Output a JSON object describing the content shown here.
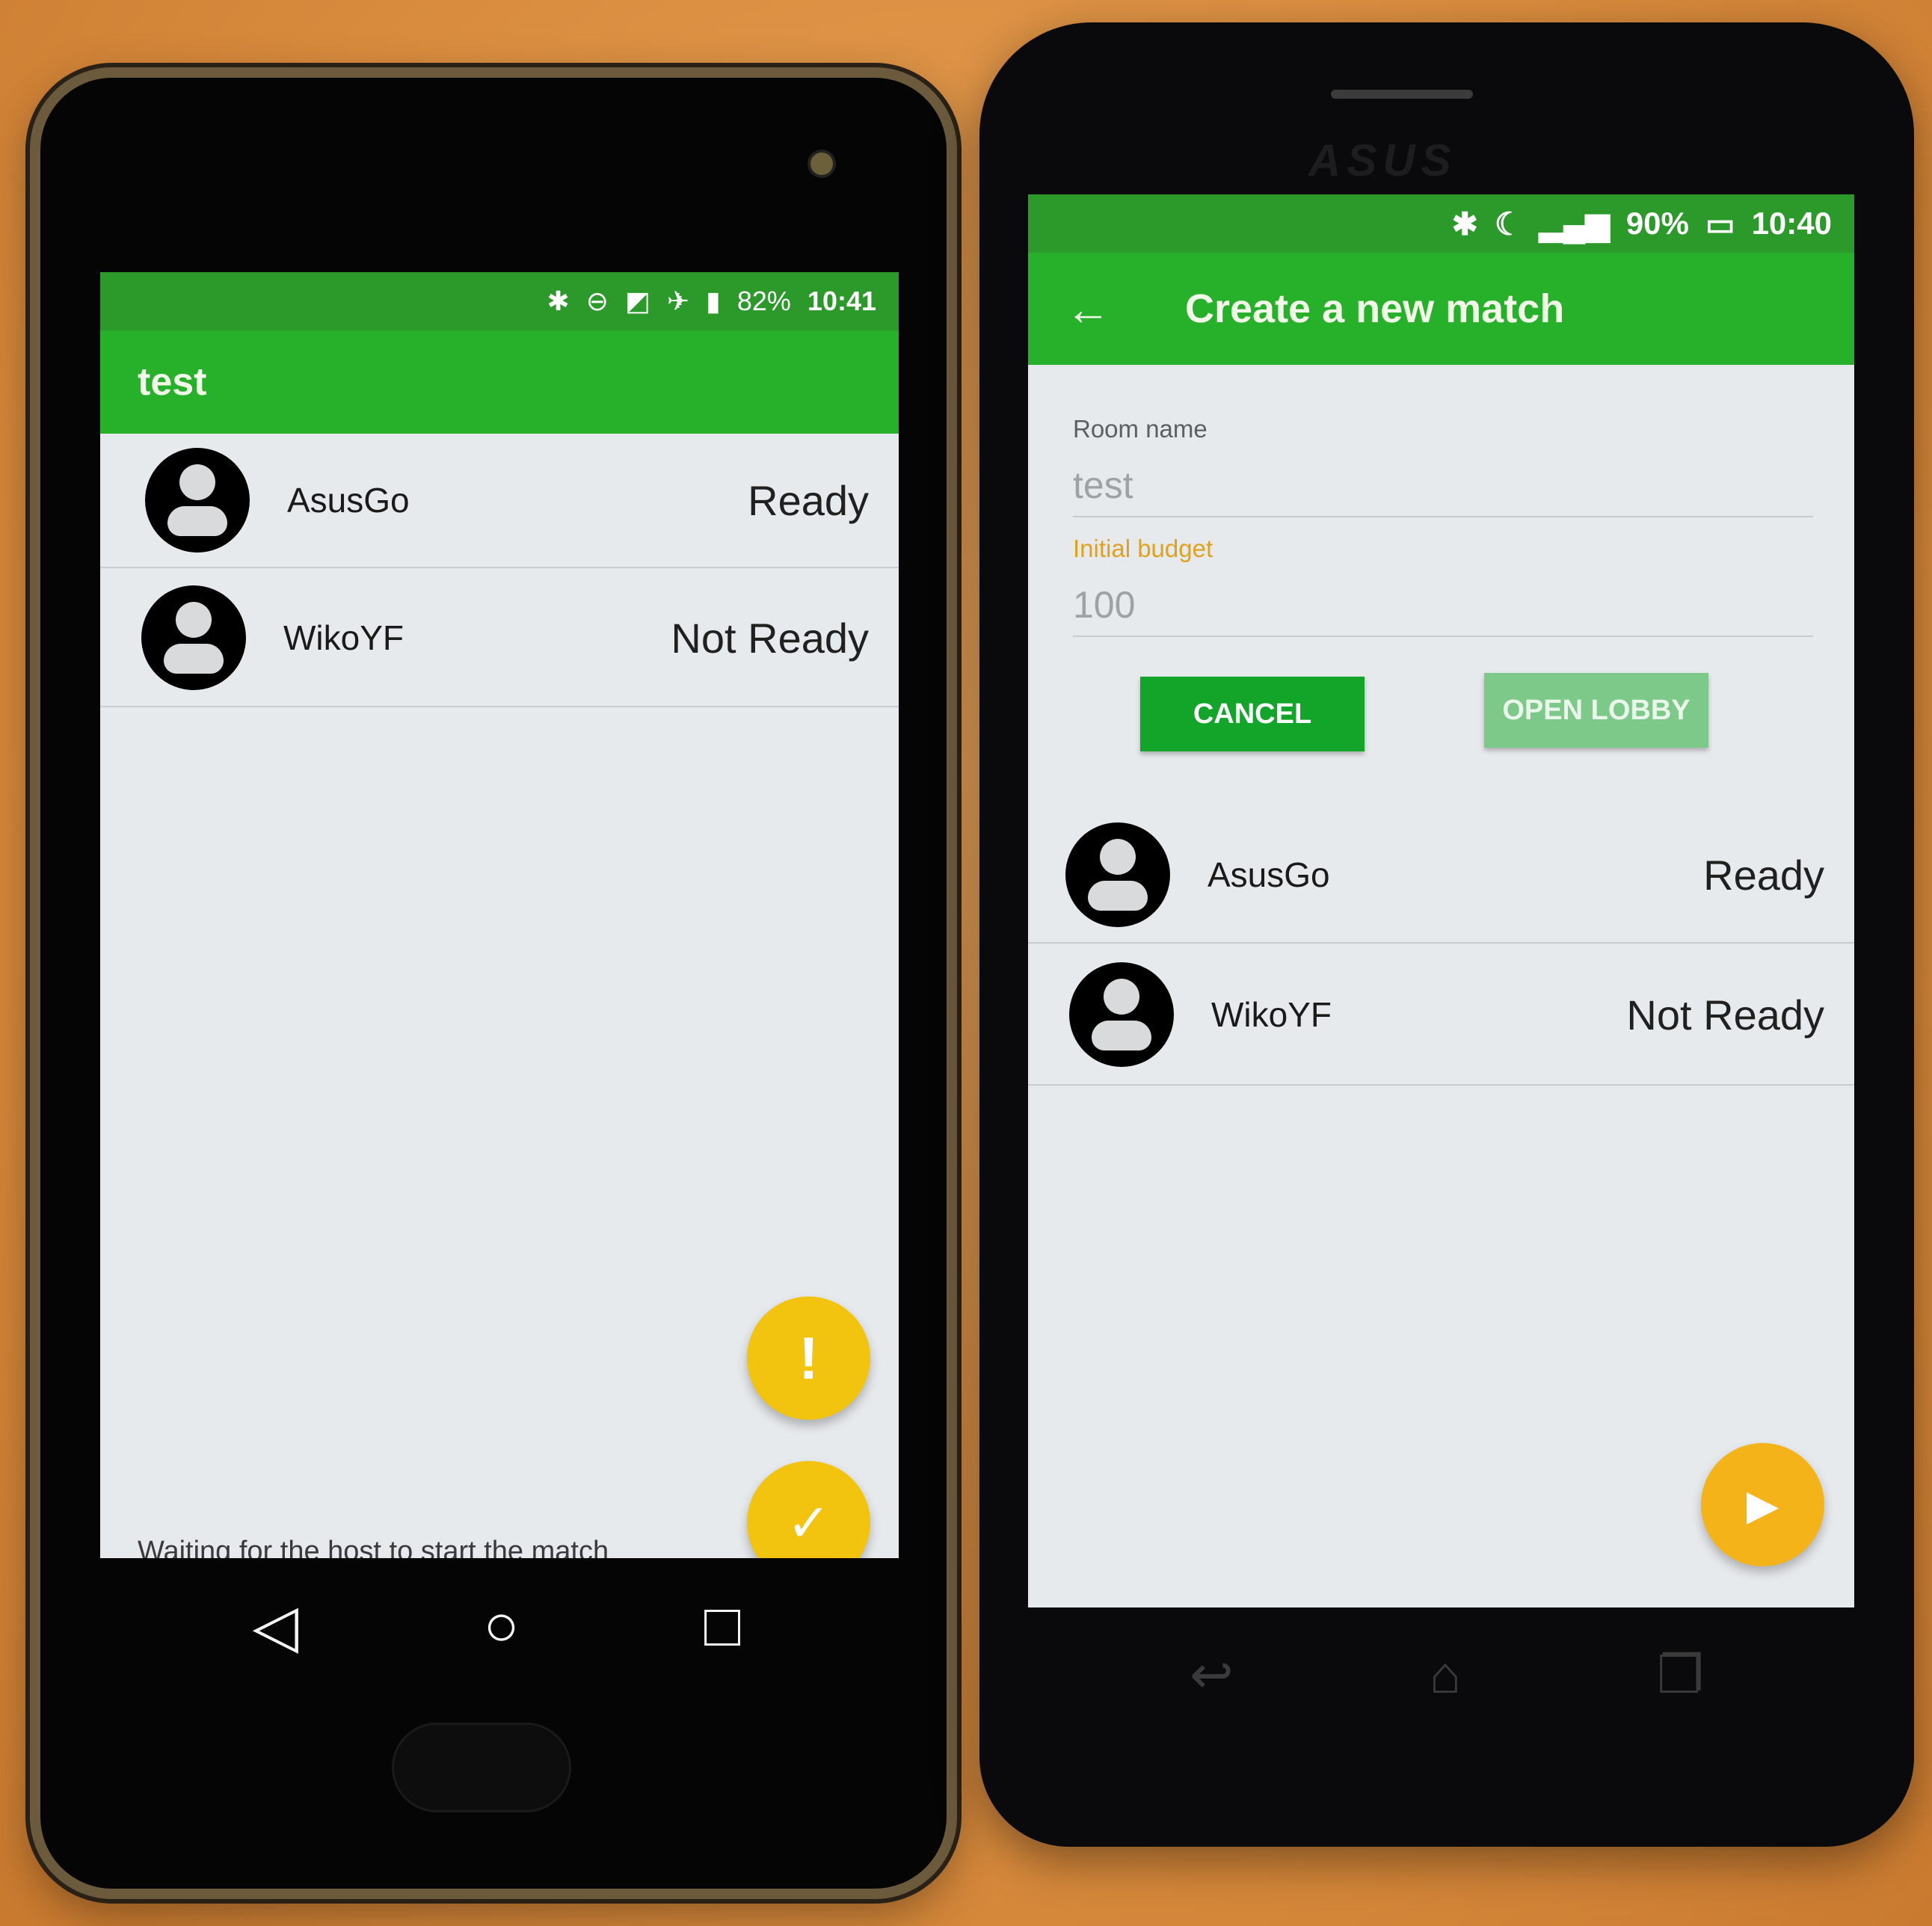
{
  "left_phone": {
    "status_bar": {
      "battery": "82%",
      "time": "10:41"
    },
    "app_bar": {
      "title": "test"
    },
    "players": [
      {
        "name": "AsusGo",
        "status": "Ready"
      },
      {
        "name": "WikoYF",
        "status": "Not Ready"
      }
    ],
    "waiting_text": "Waiting for the host to start the match",
    "fab_alert_icon": "!",
    "fab_ready_icon": "✓",
    "nav": {
      "back": "◁",
      "home": "○",
      "recents": "□"
    }
  },
  "right_phone": {
    "brand": "ASUS",
    "status_bar": {
      "battery": "90%",
      "time": "10:40"
    },
    "app_bar": {
      "back_icon": "←",
      "title": "Create a new match"
    },
    "form": {
      "room_label": "Room name",
      "room_value": "test",
      "budget_label": "Initial budget",
      "budget_value": "100"
    },
    "buttons": {
      "cancel": "CANCEL",
      "open_lobby": "OPEN LOBBY"
    },
    "players": [
      {
        "name": "AsusGo",
        "status": "Ready"
      },
      {
        "name": "WikoYF",
        "status": "Not Ready"
      }
    ],
    "fab_start_icon": "▶",
    "nav": {
      "back": "↩",
      "home": "⌂",
      "recents": "❐"
    }
  },
  "colors": {
    "status_green": "#2b9a2a",
    "appbar_green": "#27b12a",
    "button_green": "#12a52a",
    "button_disabled": "#7cc98a",
    "fab_yellow": "#f2c40f",
    "fab_orange": "#f5b31a",
    "label_orange": "#e0a21b"
  }
}
